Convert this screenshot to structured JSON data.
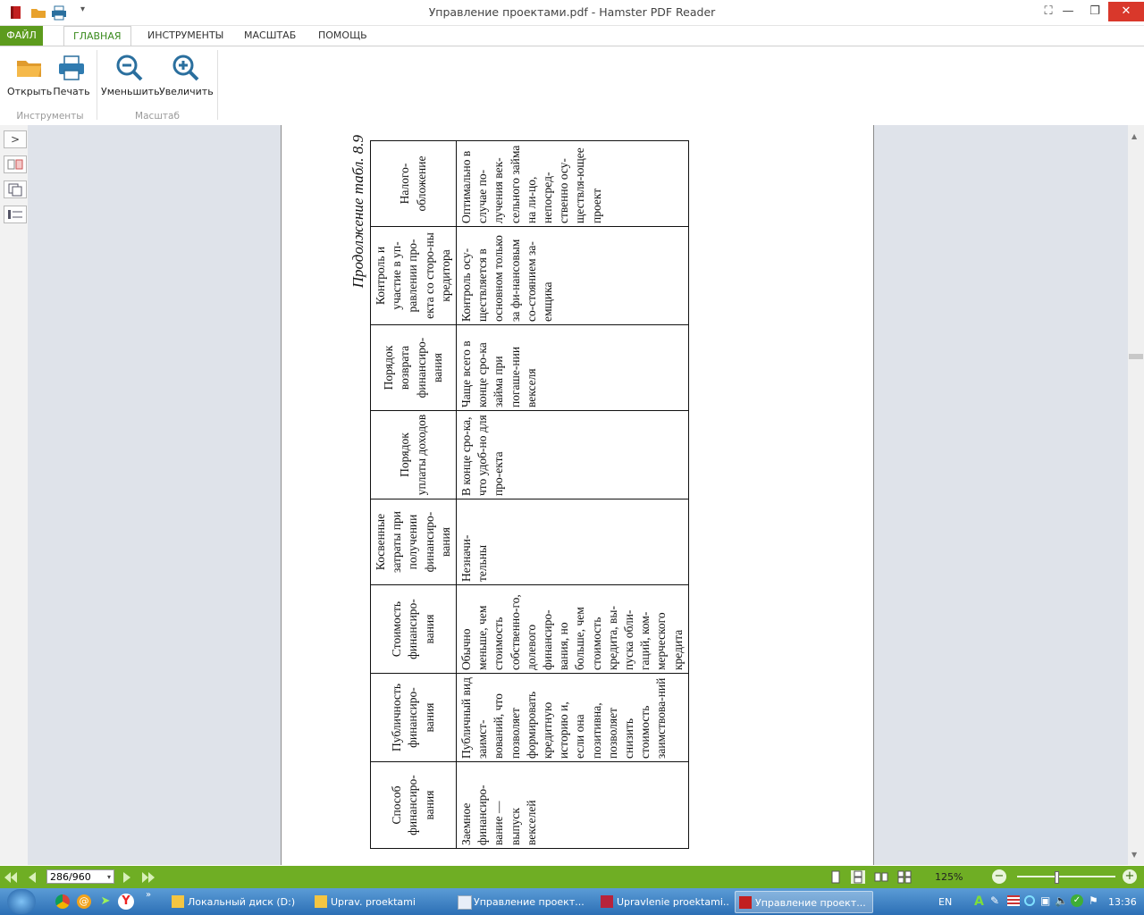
{
  "window": {
    "title": "Управление проектами.pdf - Hamster PDF Reader"
  },
  "ribbon": {
    "tabs": {
      "file": "ФАЙЛ",
      "home": "ГЛАВНАЯ",
      "tools": "ИНСТРУМЕНТЫ",
      "scale": "МАСШТАБ",
      "help": "ПОМОЩЬ"
    },
    "buttons": {
      "open": "Открыть",
      "print": "Печать",
      "zoom_out": "Уменьшить",
      "zoom_in": "Увеличить"
    },
    "groups": {
      "tools": "Инструменты",
      "scale": "Масштаб"
    }
  },
  "document": {
    "caption": "Продолжение табл. 8.9",
    "headers": [
      "Способ финансиро-вания",
      "Публичность финансиро-вания",
      "Стоимость финансиро-вания",
      "Косвенные затраты при получении финансиро-вания",
      "Порядок уплаты доходов",
      "Порядок возврата финансиро-вания",
      "Контроль и участие в уп-равлении про-екта со сторо-ны кредитора",
      "Налого-обложение"
    ],
    "row": [
      "Заемное финансиро-вание — выпуск векселей",
      "Публичный вид заимст-вований, что позволяет формировать кредитную историю и, если она позитивна, позволяет снизить стоимость заимствова-ний",
      "Обычно меньше, чем стоимость собственно-го, долевого финансиро-вания, но больше, чем стоимость кредита, вы-пуска обли-гаций, ком-мерческого кредита",
      "Незначи-тельны",
      "В конце сро-ка, что удоб-но для про-екта",
      "Чаще всего в конце сро-ка займа при погаше-нии векселя",
      "Контроль осу-ществляется в основном только за фи-нансовым со-стоянием за-емщика",
      "Оптимально в случае по-лучения век-сельного займа на ли-цо, непосред-ственно осу-ществля-ющее проект"
    ]
  },
  "navigation": {
    "page": "286/960",
    "zoom": "125%"
  },
  "taskbar": {
    "items": [
      "Локальный диск (D:)",
      "Uprav. proektami",
      "Управление проект...",
      "Upravlenie proektami...",
      "Управление проект..."
    ],
    "lang": "EN",
    "clock": "13:36"
  },
  "colors": {
    "accent": "#5c9b1d",
    "navbar": "#6fae24",
    "taskbar": "#2c6fb5"
  }
}
